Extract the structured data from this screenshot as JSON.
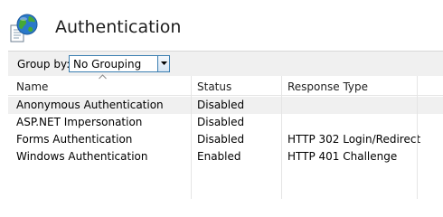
{
  "header": {
    "title": "Authentication",
    "icon": "authentication-globe-document-icon"
  },
  "toolbar": {
    "group_by_label": "Group by:",
    "group_by_value": "No Grouping"
  },
  "table": {
    "columns": [
      "Name",
      "Status",
      "Response Type"
    ],
    "rows": [
      {
        "name": "Anonymous Authentication",
        "status": "Disabled",
        "response_type": ""
      },
      {
        "name": "ASP.NET Impersonation",
        "status": "Disabled",
        "response_type": ""
      },
      {
        "name": "Forms Authentication",
        "status": "Disabled",
        "response_type": "HTTP 302 Login/Redirect"
      },
      {
        "name": "Windows Authentication",
        "status": "Enabled",
        "response_type": "HTTP 401 Challenge"
      }
    ]
  }
}
